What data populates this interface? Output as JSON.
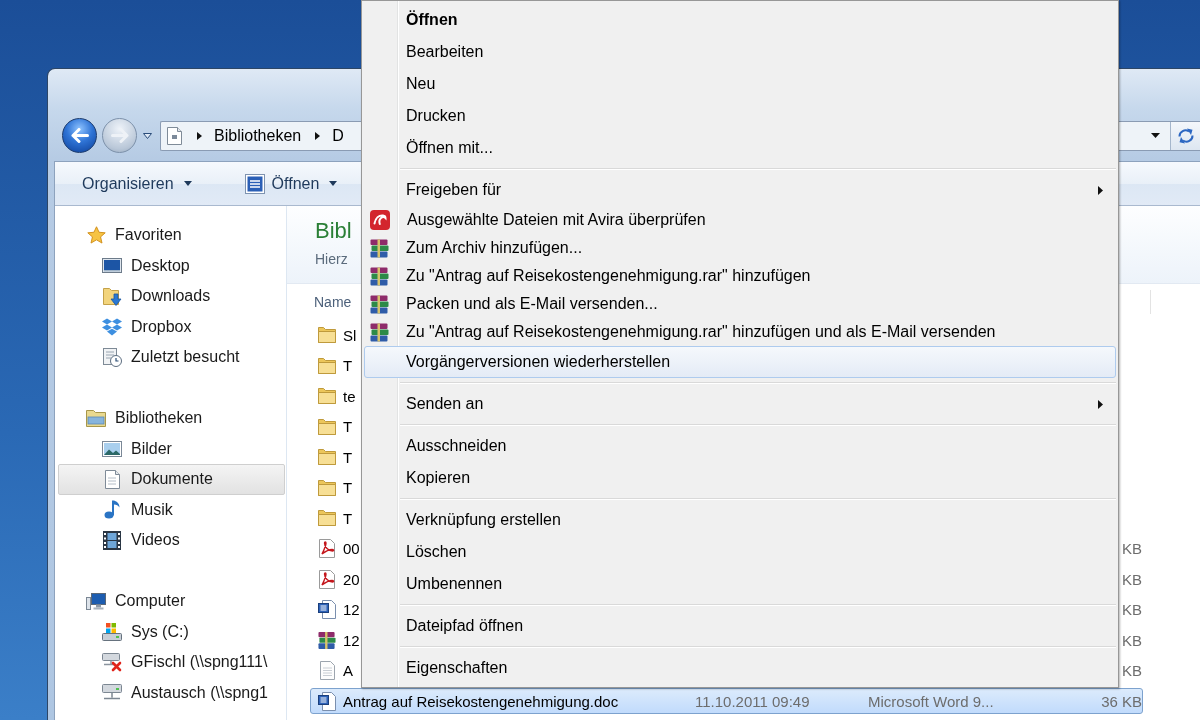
{
  "explorer": {
    "nav_buttons": [
      {
        "kind": "back",
        "disabled": false
      },
      {
        "kind": "forward",
        "disabled": true
      }
    ],
    "address_bar": {
      "crumbs": [
        "Bibliotheken",
        "D"
      ]
    },
    "toolbar": [
      {
        "label": "Organisieren",
        "kind": "plain"
      },
      {
        "label": "Öffnen",
        "kind": "document"
      }
    ],
    "nav_pane": [
      {
        "label": "Favoriten",
        "kind": "favorites",
        "selected": false,
        "children": [
          {
            "label": "Desktop",
            "kind": "desktop",
            "selected": false
          },
          {
            "label": "Downloads",
            "kind": "downloads",
            "selected": false
          },
          {
            "label": "Dropbox",
            "kind": "dropbox",
            "selected": false
          },
          {
            "label": "Zuletzt besucht",
            "kind": "recent",
            "selected": false
          }
        ]
      },
      {
        "label": "Bibliotheken",
        "kind": "libraries",
        "selected": false,
        "children": [
          {
            "label": "Bilder",
            "kind": "pictures",
            "selected": false
          },
          {
            "label": "Dokumente",
            "kind": "documents",
            "selected": true
          },
          {
            "label": "Musik",
            "kind": "music",
            "selected": false
          },
          {
            "label": "Videos",
            "kind": "videos",
            "selected": false
          }
        ]
      },
      {
        "label": "Computer",
        "kind": "computer",
        "selected": false,
        "children": [
          {
            "label": "Sys (C:)",
            "kind": "drive",
            "selected": false
          },
          {
            "label": "GFischl (\\\\spng111\\",
            "kind": "offline",
            "selected": false
          },
          {
            "label": "Austausch (\\\\spng1",
            "kind": "network",
            "selected": false
          }
        ]
      }
    ],
    "library": {
      "title": "Bibl",
      "subtitle": "Hierz"
    },
    "columns": [
      "Name"
    ],
    "files": [
      {
        "kind": "folder",
        "name": "Sl",
        "selected": false
      },
      {
        "kind": "folder",
        "name": "T",
        "selected": false
      },
      {
        "kind": "folder",
        "name": "te",
        "selected": false
      },
      {
        "kind": "folder",
        "name": "T",
        "selected": false
      },
      {
        "kind": "folder",
        "name": "T",
        "selected": false
      },
      {
        "kind": "folder",
        "name": "T",
        "selected": false
      },
      {
        "kind": "folder",
        "name": "T",
        "selected": false
      },
      {
        "kind": "pdf",
        "name": "00",
        "size": "KB",
        "selected": false
      },
      {
        "kind": "pdf",
        "name": "20",
        "size": "KB",
        "selected": false
      },
      {
        "kind": "word",
        "name": "12",
        "size": "KB",
        "selected": false
      },
      {
        "kind": "archive",
        "name": "12",
        "size": "KB",
        "selected": false
      },
      {
        "kind": "text",
        "name": "A",
        "size": "KB",
        "selected": false
      },
      {
        "kind": "word",
        "name": "Antrag auf Reisekostengenehmigung.doc",
        "date": "11.10.2011 09:49",
        "type": "Microsoft Word 9...",
        "size": "36 KB",
        "selected": true
      }
    ]
  },
  "context_menu": {
    "groups": [
      [
        {
          "label": "Öffnen",
          "kind": "plain",
          "default": true,
          "submenu": false,
          "selected": false
        },
        {
          "label": "Bearbeiten",
          "kind": "plain",
          "default": false,
          "submenu": false,
          "selected": false
        },
        {
          "label": "Neu",
          "kind": "plain",
          "default": false,
          "submenu": false,
          "selected": false
        },
        {
          "label": "Drucken",
          "kind": "plain",
          "default": false,
          "submenu": false,
          "selected": false
        },
        {
          "label": "Öffnen mit...",
          "kind": "plain",
          "default": false,
          "submenu": false,
          "selected": false
        }
      ],
      [
        {
          "label": "Freigeben für",
          "kind": "plain",
          "default": false,
          "submenu": true,
          "selected": false
        },
        {
          "label": "Ausgewählte Dateien mit Avira überprüfen",
          "kind": "scan",
          "default": false,
          "submenu": false,
          "selected": false
        },
        {
          "label": "Zum Archiv hinzufügen...",
          "kind": "archive",
          "default": false,
          "submenu": false,
          "selected": false
        },
        {
          "label": "Zu \"Antrag auf Reisekostengenehmigung.rar\" hinzufügen",
          "kind": "archive",
          "default": false,
          "submenu": false,
          "selected": false
        },
        {
          "label": "Packen und als E-Mail versenden...",
          "kind": "archive",
          "default": false,
          "submenu": false,
          "selected": false
        },
        {
          "label": "Zu \"Antrag auf Reisekostengenehmigung.rar\" hinzufügen und als E-Mail versenden",
          "kind": "archive",
          "default": false,
          "submenu": false,
          "selected": false
        },
        {
          "label": "Vorgängerversionen wiederherstellen",
          "kind": "plain",
          "default": false,
          "submenu": false,
          "selected": true
        }
      ],
      [
        {
          "label": "Senden an",
          "kind": "plain",
          "default": false,
          "submenu": true,
          "selected": false
        }
      ],
      [
        {
          "label": "Ausschneiden",
          "kind": "plain",
          "default": false,
          "submenu": false,
          "selected": false
        },
        {
          "label": "Kopieren",
          "kind": "plain",
          "default": false,
          "submenu": false,
          "selected": false
        }
      ],
      [
        {
          "label": "Verknüpfung erstellen",
          "kind": "plain",
          "default": false,
          "submenu": false,
          "selected": false
        },
        {
          "label": "Löschen",
          "kind": "plain",
          "default": false,
          "submenu": false,
          "selected": false
        },
        {
          "label": "Umbenennen",
          "kind": "plain",
          "default": false,
          "submenu": false,
          "selected": false
        }
      ],
      [
        {
          "label": "Dateipfad öffnen",
          "kind": "plain",
          "default": false,
          "submenu": false,
          "selected": false
        }
      ],
      [
        {
          "label": "Eigenschaften",
          "kind": "plain",
          "default": false,
          "submenu": false,
          "selected": false
        }
      ]
    ]
  }
}
